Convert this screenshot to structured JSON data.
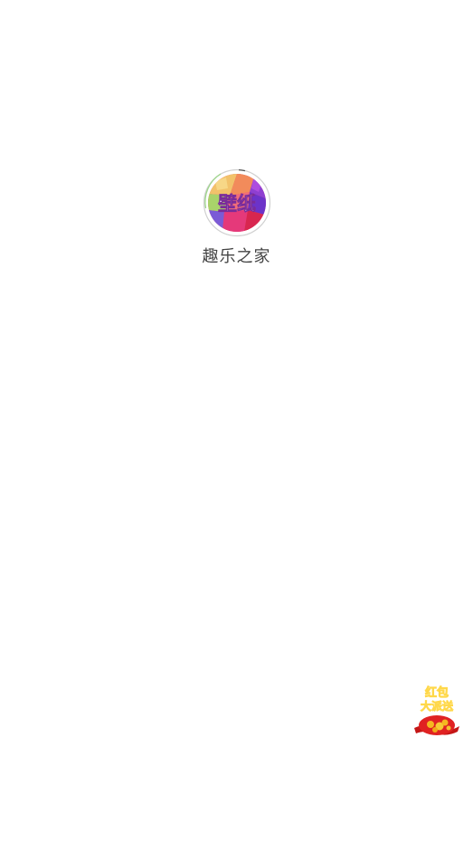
{
  "app": {
    "icon_label": "壁纸",
    "name": "趣乐之家"
  },
  "promo": {
    "line1": "红包",
    "line2": "大派送"
  },
  "colors": {
    "background": "#ffffff",
    "app_name_text": "#444444",
    "progress_ring": "#8fd27a",
    "promo_red": "#d21f1f"
  }
}
